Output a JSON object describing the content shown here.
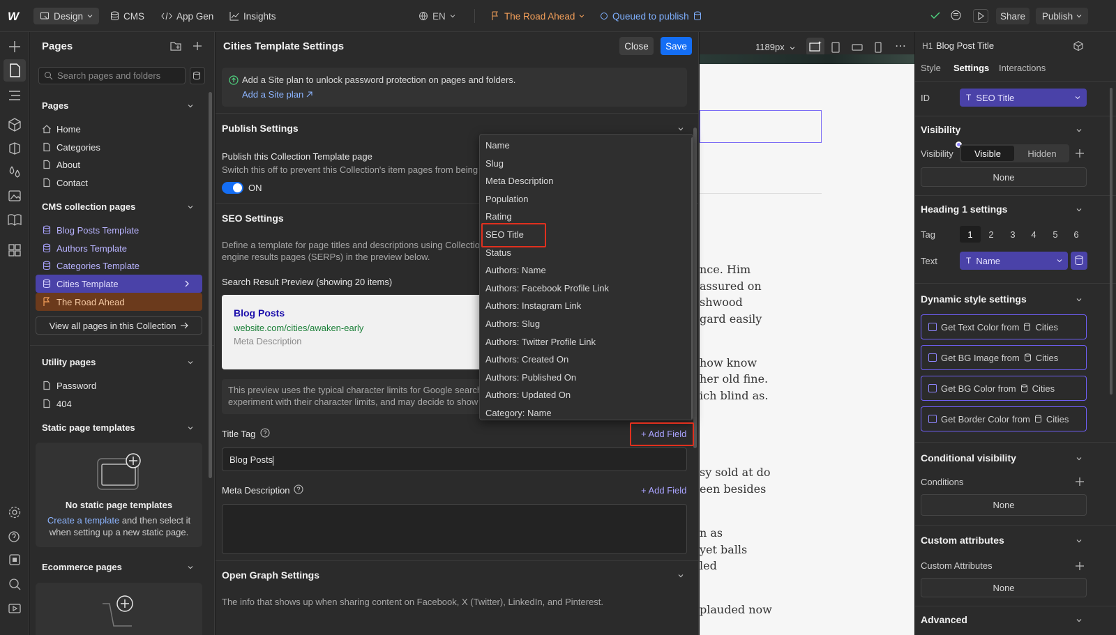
{
  "topbar": {
    "design": "Design",
    "cms": "CMS",
    "app_gen": "App Gen",
    "insights": "Insights",
    "locale": "EN",
    "page_name": "The Road Ahead",
    "queued": "Queued to publish",
    "share": "Share",
    "publish": "Publish"
  },
  "pages_panel": {
    "title": "Pages",
    "search_placeholder": "Search pages and folders",
    "pages_section": "Pages",
    "pages": [
      "Home",
      "Categories",
      "About",
      "Contact"
    ],
    "cms_section": "CMS collection pages",
    "cms_pages": [
      "Blog Posts Template",
      "Authors Template",
      "Categories Template",
      "Cities Template",
      "The Road Ahead"
    ],
    "view_all": "View all pages in this Collection",
    "utility_section": "Utility pages",
    "utility_pages": [
      "Password",
      "404"
    ],
    "static_section": "Static page templates",
    "no_static_title": "No static page templates",
    "create_template_link": "Create a template",
    "create_template_rest": " and then select it when setting up a new static page.",
    "ecommerce_section": "Ecommerce pages"
  },
  "settings": {
    "title": "Cities Template Settings",
    "close": "Close",
    "save": "Save",
    "site_plan_msg": "Add a Site plan to unlock password protection on pages and folders.",
    "site_plan_link": "Add a Site plan",
    "publish_settings": "Publish Settings",
    "publish_toggle_label": "Publish this Collection Template page",
    "publish_toggle_desc": "Switch this off to prevent this Collection's item pages from being",
    "toggle_state": "ON",
    "seo_settings": "SEO Settings",
    "seo_desc_1": "Define a template for page titles and descriptions using Collection",
    "seo_desc_2": "engine results pages (SERPs) in the preview below.",
    "preview_label": "Search Result Preview (showing 20 items)",
    "preview_title": "Blog Posts",
    "preview_url": "website.com/cities/awaken-early",
    "preview_meta": "Meta Description",
    "char_note_1": "This preview uses the typical character limits for Google search",
    "char_note_2": "experiment with their character limits, and may decide to show",
    "title_tag_label": "Title Tag",
    "add_field": "+ Add Field",
    "title_tag_value": "Blog Posts",
    "meta_label": "Meta Description",
    "og_settings": "Open Graph Settings",
    "og_desc": "The info that shows up when sharing content on Facebook, X (Twitter), LinkedIn, and Pinterest."
  },
  "dropdown": {
    "items": [
      "Name",
      "Slug",
      "Meta Description",
      "Population",
      "Rating",
      "SEO Title",
      "Status",
      "Authors: Name",
      "Authors: Facebook Profile Link",
      "Authors: Instagram Link",
      "Authors: Slug",
      "Authors: Twitter Profile Link",
      "Authors: Created On",
      "Authors: Published On",
      "Authors: Updated On",
      "Category: Name"
    ],
    "highlighted": "SEO Title"
  },
  "canvas": {
    "width_readout": "1189px",
    "text_lines": [
      "nce. Him",
      "assured on",
      "shwood",
      "gard easily",
      "how know",
      "her old fine.",
      "ich blind as.",
      "sy sold at do",
      "een besides",
      "n as",
      "yet balls",
      "led",
      "plauded now"
    ]
  },
  "right_panel": {
    "element_tag": "H1",
    "element_name": "Blog Post Title",
    "tabs": [
      "Style",
      "Settings",
      "Interactions"
    ],
    "active_tab": "Settings",
    "id_label": "ID",
    "id_value": "SEO Title",
    "visibility_section": "Visibility",
    "visibility_label": "Visibility",
    "visible": "Visible",
    "hidden": "Hidden",
    "none": "None",
    "heading_section": "Heading 1 settings",
    "tag_label": "Tag",
    "tag_options": [
      "1",
      "2",
      "3",
      "4",
      "5",
      "6"
    ],
    "text_label": "Text",
    "text_value": "Name",
    "dynamic_section": "Dynamic style settings",
    "dynamic_items": [
      {
        "label": "Get Text Color from",
        "source": "Cities"
      },
      {
        "label": "Get BG Image from",
        "source": "Cities"
      },
      {
        "label": "Get BG Color from",
        "source": "Cities"
      },
      {
        "label": "Get Border Color from",
        "source": "Cities"
      }
    ],
    "conditional_section": "Conditional visibility",
    "conditions_label": "Conditions",
    "custom_attr_section": "Custom attributes",
    "custom_attr_label": "Custom Attributes",
    "advanced_section": "Advanced"
  },
  "colors": {
    "accent": "#146ef5",
    "cms_purple": "#a9a3ff",
    "page_orange": "#f5a05a",
    "highlight_red": "#e0301e"
  }
}
